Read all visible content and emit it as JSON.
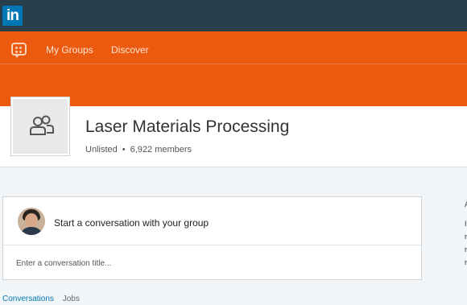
{
  "topbar": {
    "logo_text": "in",
    "logo_color": "#0077b5",
    "background": "#283e4a"
  },
  "nav": {
    "background": "#ec5a0f",
    "icon": "groups-chat-icon",
    "items": [
      {
        "label": "My Groups"
      },
      {
        "label": "Discover"
      }
    ]
  },
  "group": {
    "icon": "group-people-icon",
    "title": "Laser Materials Processing",
    "visibility": "Unlisted",
    "separator": "•",
    "members": "6,922 members"
  },
  "conversation": {
    "prompt": "Start a conversation with your group",
    "title_placeholder": "Enter a conversation title..."
  },
  "tabs": [
    {
      "label": "Conversations",
      "active": true
    },
    {
      "label": "Jobs",
      "active": false
    }
  ],
  "sidebar_clipped": {
    "letters": [
      "A",
      "I",
      "r",
      "r",
      "r"
    ]
  }
}
